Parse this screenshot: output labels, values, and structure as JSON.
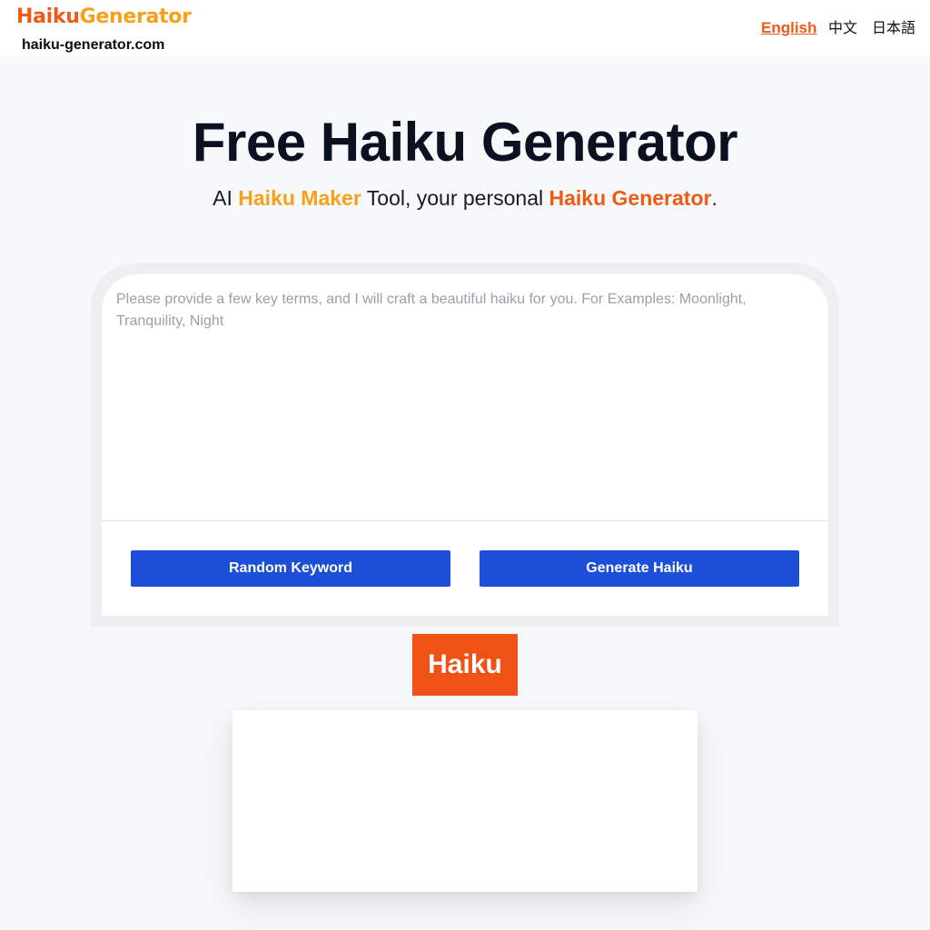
{
  "header": {
    "logo": {
      "part1": "Haiku",
      "part2": "Generator"
    },
    "domain": "haiku-generator.com",
    "languages": [
      {
        "label": "English",
        "active": true
      },
      {
        "label": "中文",
        "active": false
      },
      {
        "label": "日本語",
        "active": false
      }
    ]
  },
  "hero": {
    "title": "Free Haiku Generator",
    "subtitle": {
      "prefix": "AI ",
      "highlight1": "Haiku Maker",
      "middle": " Tool, your personal ",
      "highlight2": "Haiku Generator",
      "suffix": "."
    }
  },
  "form": {
    "keywords_placeholder": "Please provide a few key terms, and I will craft a beautiful haiku for you. For Examples: Moonlight, Tranquility, Night",
    "keywords_value": "",
    "random_button": "Random Keyword",
    "generate_button": "Generate Haiku"
  },
  "result": {
    "badge": "Haiku",
    "text": ""
  },
  "colors": {
    "brand_orange": "#ef5a14",
    "brand_amber": "#f7a11a",
    "button_blue": "#1d4ed8",
    "badge_orange": "#f05114"
  }
}
